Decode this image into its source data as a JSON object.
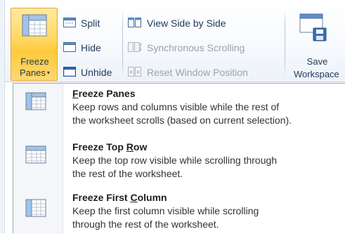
{
  "ribbon": {
    "freeze_panes": {
      "label_line1": "Freeze",
      "label_line2": "Panes",
      "caret": "▾",
      "icon": "freeze-panes-icon"
    },
    "split": {
      "label": "Split",
      "icon": "split-icon"
    },
    "hide": {
      "label": "Hide",
      "icon": "hide-icon"
    },
    "unhide": {
      "label": "Unhide",
      "icon": "unhide-icon"
    },
    "view_side_by_side": {
      "label": "View Side by Side",
      "icon": "view-side-by-side-icon",
      "enabled": true
    },
    "synchronous_scrolling": {
      "label": "Synchronous Scrolling",
      "icon": "synchronous-scrolling-icon",
      "enabled": false
    },
    "reset_window_position": {
      "label": "Reset Window Position",
      "icon": "reset-window-position-icon",
      "enabled": false
    },
    "save_workspace": {
      "label_line1": "Save",
      "label_line2": "Workspace",
      "icon": "save-workspace-icon"
    }
  },
  "menu": {
    "items": [
      {
        "title_pre": "",
        "title_accel": "F",
        "title_post": "reeze Panes",
        "desc_line1": "Keep rows and columns visible while the rest of",
        "desc_line2": "the worksheet scrolls (based on current selection).",
        "icon": "freeze-panes-icon"
      },
      {
        "title_pre": "Freeze Top ",
        "title_accel": "R",
        "title_post": "ow",
        "desc_line1": "Keep the top row visible while scrolling through",
        "desc_line2": "the rest of the worksheet.",
        "icon": "freeze-top-row-icon"
      },
      {
        "title_pre": "Freeze First ",
        "title_accel": "C",
        "title_post": "olumn",
        "desc_line1": "Keep the first column visible while scrolling",
        "desc_line2": "through the rest of the worksheet.",
        "icon": "freeze-first-column-icon"
      }
    ]
  },
  "colors": {
    "active_button_top": "#ffeaa0",
    "active_button_bottom": "#ffc93c",
    "active_button_border": "#e3a73b",
    "ribbon_text": "#1e395b",
    "disabled_text": "#9aa3ae"
  }
}
